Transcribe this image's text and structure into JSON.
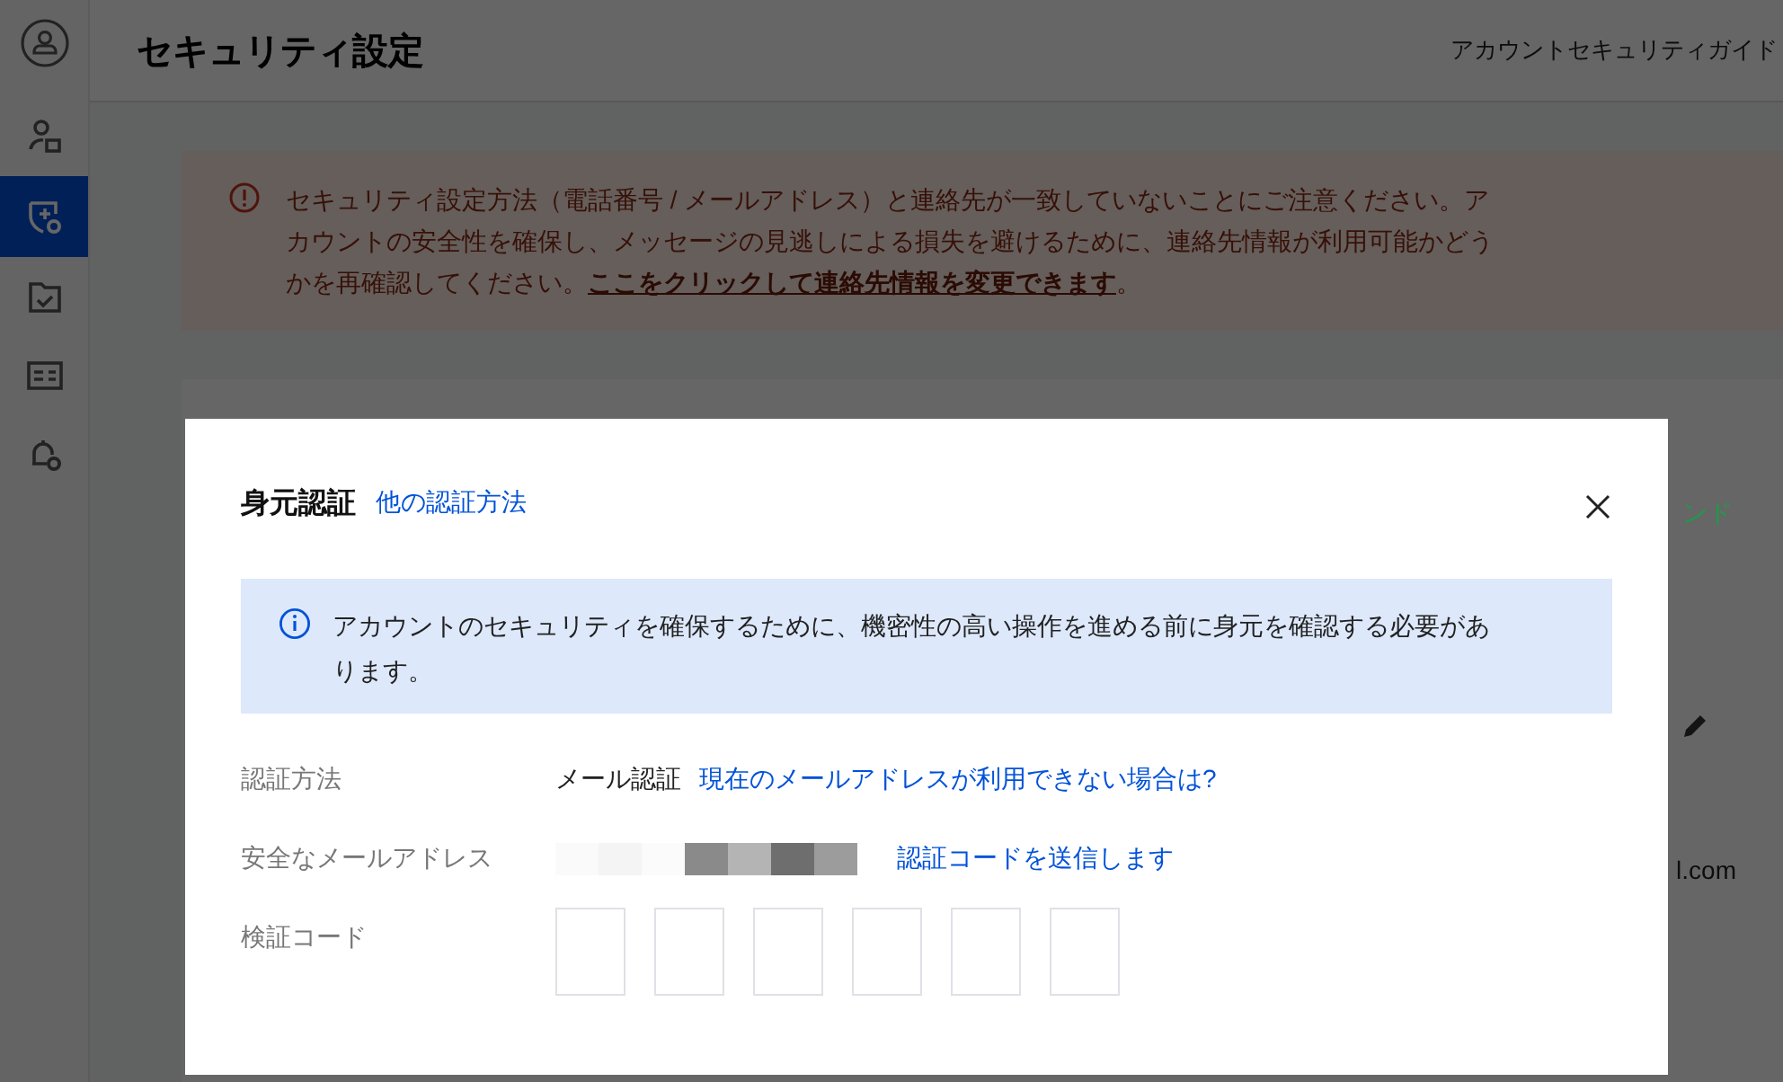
{
  "sidebar": {
    "items": [
      {
        "kind": "avatar",
        "selected": false
      },
      {
        "kind": "user",
        "selected": false
      },
      {
        "kind": "shield",
        "selected": true
      },
      {
        "kind": "folder",
        "selected": false
      },
      {
        "kind": "card",
        "selected": false
      },
      {
        "kind": "bell",
        "selected": false
      }
    ]
  },
  "header": {
    "title": "セキュリティ設定",
    "link": "アカウントセキュリティガイド"
  },
  "alert": {
    "text": "セキュリティ設定方法（電話番号 / メールアドレス）と連絡先が一致していないことにご注意ください。アカウントの安全性を確保し、メッセージの見逃しによる損失を避けるために、連絡先情報が利用可能かどうかを再確認してください。",
    "link": "ここをクリックして連絡先情報を変更できます",
    "tail": "。"
  },
  "background_card": {
    "green_text": "ンド",
    "email_tail": "l.com"
  },
  "dialog": {
    "title": "身元認証",
    "title_link": "他の認証方法",
    "notice": "アカウントのセキュリティを確保するために、機密性の高い操作を進める前に身元を確認する必要があります。",
    "rows": [
      {
        "kind": "method",
        "label": "認証方法",
        "value": "メール認証",
        "link": "現在のメールアドレスが利用できない場合は?"
      },
      {
        "kind": "email",
        "label": "安全なメールアドレス",
        "link": "認証コードを送信します"
      },
      {
        "kind": "code",
        "label": "検証コード"
      }
    ]
  }
}
